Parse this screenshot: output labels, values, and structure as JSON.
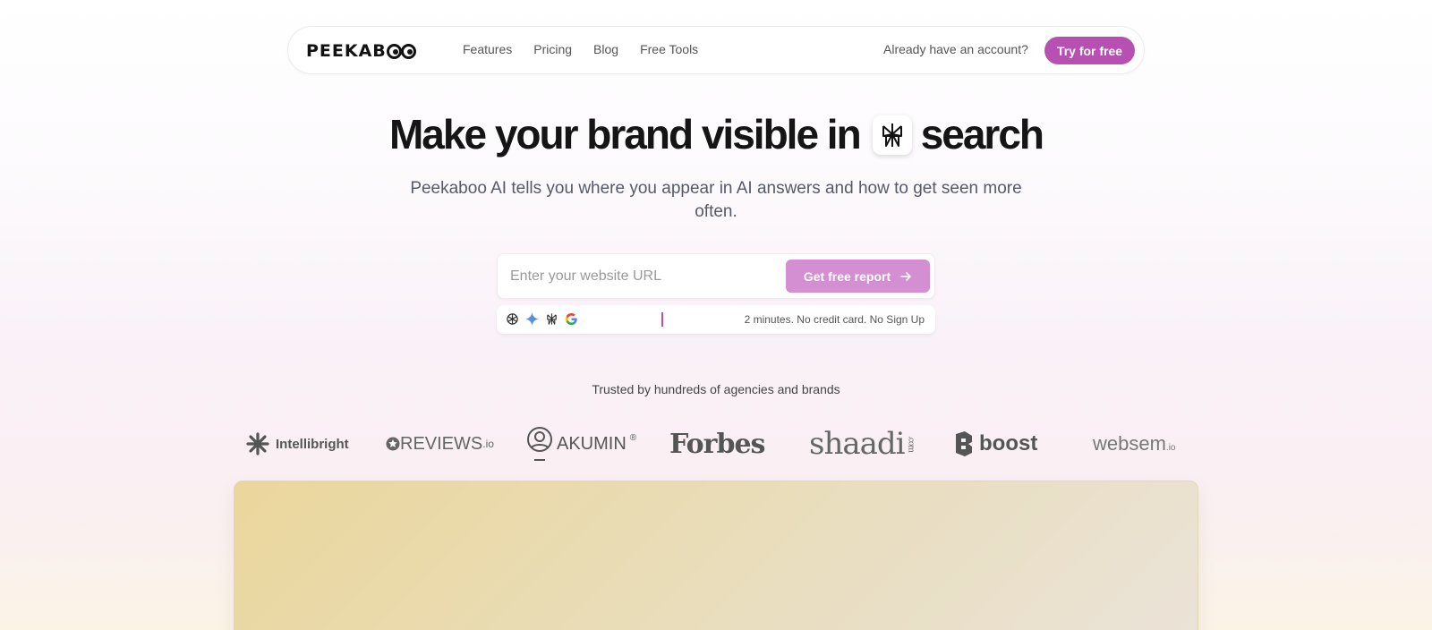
{
  "nav": {
    "logo_text": "PEEKAB",
    "links": [
      {
        "label": "Features"
      },
      {
        "label": "Pricing"
      },
      {
        "label": "Blog"
      },
      {
        "label": "Free Tools"
      }
    ],
    "login_label": "Already have an account?",
    "cta_label": "Try for free"
  },
  "hero": {
    "title_before": "Make your brand visible in",
    "title_after": "search",
    "title_icon": "perplexity-icon",
    "subtitle": "Peekaboo AI tells you where you appear in AI answers and how to get seen more often."
  },
  "form": {
    "url_placeholder": "Enter your website URL",
    "url_value": "",
    "submit_label": "Get free report",
    "engine_icons": [
      "chatgpt-icon",
      "gemini-icon",
      "perplexity-icon",
      "google-icon"
    ],
    "note": "2 minutes. No credit card. No Sign Up"
  },
  "trusted": {
    "heading": "Trusted by hundreds of agencies and brands",
    "brands": {
      "intellibright": "Intellibright",
      "reviews": "REVIEWS",
      "reviews_suffix": ".io",
      "akumin": "AKUMIN",
      "akumin_mark": "®",
      "forbes": "Forbes",
      "shaadi": "shaadi",
      "shaadi_suffix": ".com",
      "boost": "boost",
      "websem": "websem",
      "websem_suffix": ".io"
    }
  },
  "colors": {
    "accent": "#b84fb3",
    "button_light": "#d38fd1",
    "preview_bg": "#ebd69c"
  }
}
